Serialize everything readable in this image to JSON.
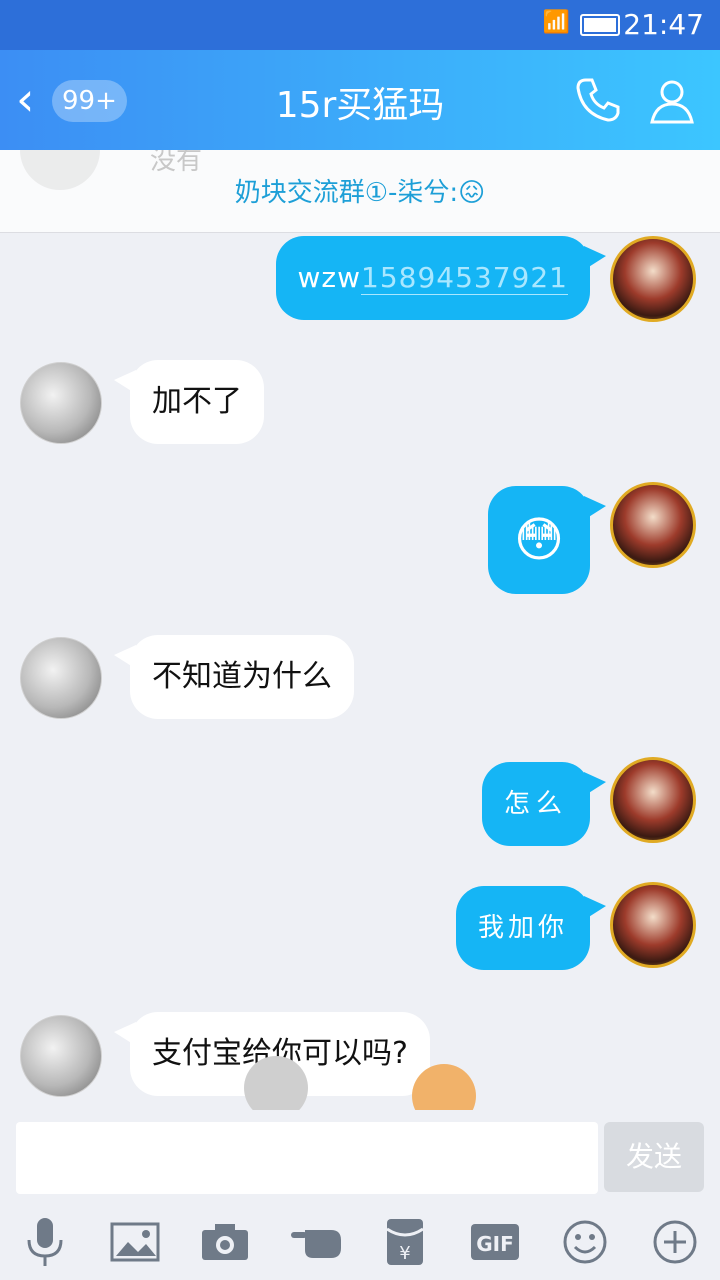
{
  "status_bar": {
    "time": "21:47",
    "network": "4G"
  },
  "header": {
    "back_icon": "chevron-left-icon",
    "unread_badge": "99+",
    "title": "15r买猛玛",
    "call_icon": "phone-icon",
    "profile_icon": "user-icon"
  },
  "notice": {
    "ghost_text": "没有",
    "text": "奶块交流群①-柒兮:😖"
  },
  "messages": [
    {
      "side": "right",
      "prefix": "wzw",
      "link": "15894537921"
    },
    {
      "side": "left",
      "text": "加不了"
    },
    {
      "side": "right",
      "text": "😳"
    },
    {
      "side": "left",
      "text": "不知道为什么"
    },
    {
      "side": "right",
      "text": "怎么"
    },
    {
      "side": "right",
      "text": "我加你"
    },
    {
      "side": "left",
      "text": "支付宝给你可以吗?"
    }
  ],
  "input": {
    "placeholder": "",
    "send_label": "发送"
  },
  "toolbar": {
    "icons": [
      "microphone-icon",
      "image-icon",
      "camera-icon",
      "poke-icon",
      "red-packet-icon",
      "gif-icon",
      "emoji-icon",
      "plus-icon"
    ],
    "gif_label": "GIF"
  },
  "colors": {
    "header_gradient_start": "#3c8ef4",
    "header_gradient_end": "#3cc6ff",
    "bubble_blue": "#15b5f5",
    "background": "#eef0f5"
  }
}
